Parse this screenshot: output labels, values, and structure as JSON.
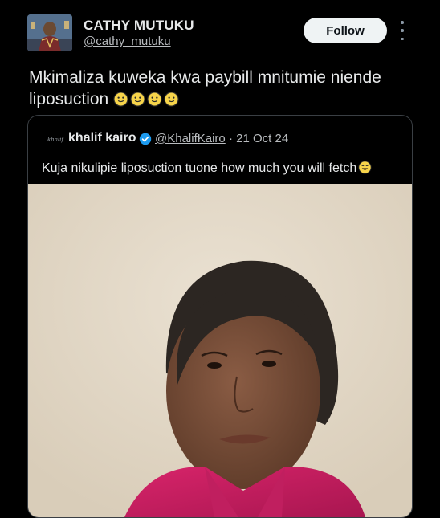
{
  "author": {
    "name": "CATHY MUTUKU",
    "handle": "@cathy_mutuku"
  },
  "follow_label": "Follow",
  "tweet": {
    "text": "Mkimaliza kuweka kwa paybill mnitumie niende liposuction",
    "emoji_icons": [
      "slightly-smiling-face",
      "slightly-smiling-face",
      "slightly-smiling-face",
      "slightly-smiling-face"
    ]
  },
  "quote": {
    "logo_text": "khalif",
    "name": "khalif kairo",
    "verified_color": "#1d9bf0",
    "handle": "@KhalifKairo",
    "separator": "·",
    "date": "21 Oct 24",
    "text": "Kuja nikulipie liposuction tuone how much you will fetch",
    "emoji_icon": "grinning-face-with-sweat"
  },
  "colors": {
    "background": "#000000",
    "text": "#e7e9ea",
    "secondary_text": "#b9bcbf",
    "follow_button_bg": "#eff3f4",
    "border": "#3a3f44"
  }
}
